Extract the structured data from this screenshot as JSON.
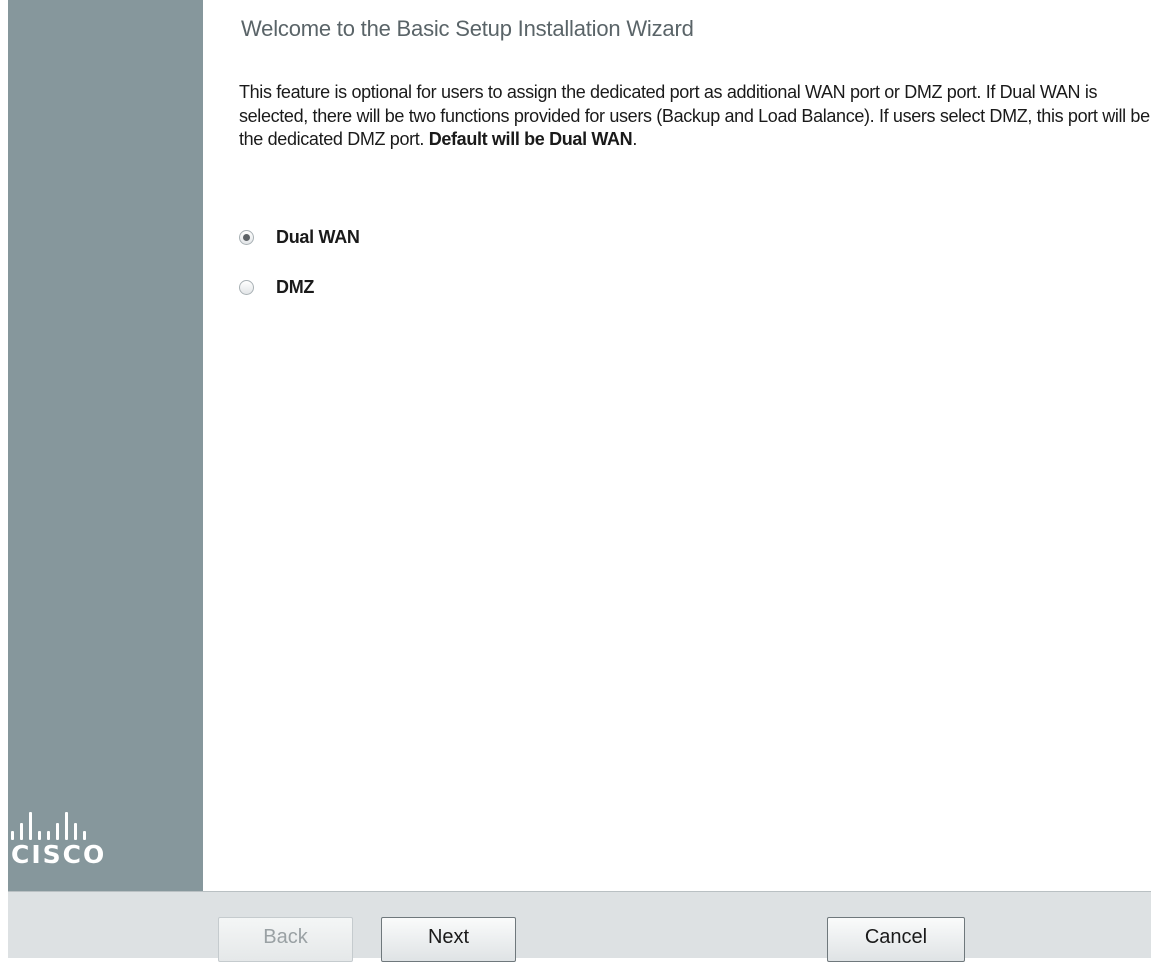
{
  "wizard": {
    "title": "Welcome to the Basic Setup Installation Wizard",
    "description_part1": "This feature is optional for users to assign the dedicated port as additional WAN port or DMZ port. If Dual WAN is selected, there will be two functions provided for users (Backup and Load Balance). If users select DMZ, this port will be the dedicated DMZ port. ",
    "description_bold": "Default will be Dual WAN",
    "description_end": ".",
    "options": [
      {
        "label": "Dual WAN",
        "selected": true
      },
      {
        "label": "DMZ",
        "selected": false
      }
    ]
  },
  "brand": {
    "name": "CISCO",
    "logo_icon": "cisco-bars-icon"
  },
  "footer": {
    "back_label": "Back",
    "next_label": "Next",
    "cancel_label": "Cancel",
    "back_disabled": true
  },
  "colors": {
    "sidebar": "#86979c",
    "footer": "#dde1e3",
    "title": "#5a6468"
  }
}
